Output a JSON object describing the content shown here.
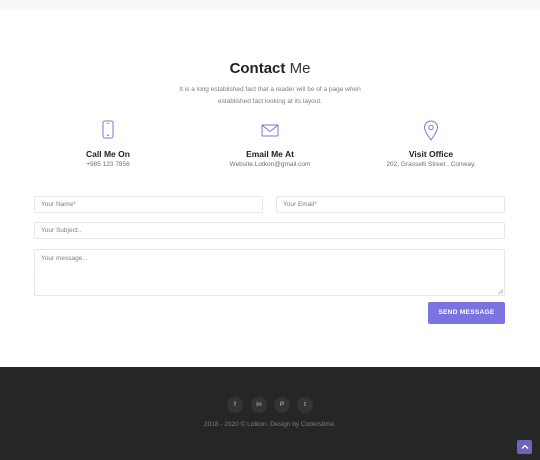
{
  "header": {
    "title_bold": "Contact",
    "title_light": "Me",
    "subtitle": "It is a long established fact that a reader will be of a page when established fact looking at its layout."
  },
  "info": [
    {
      "icon": "phone-icon",
      "label": "Call Me On",
      "value": "+985 123 7856"
    },
    {
      "icon": "mail-icon",
      "label": "Email Me At",
      "value": "Website.Lotkon@gmail.com"
    },
    {
      "icon": "location-pin-icon",
      "label": "Visit Office",
      "value": "202, Grasselli Street , Conway."
    }
  ],
  "form": {
    "name_placeholder": "Your Name*",
    "email_placeholder": "Your Email*",
    "subject_placeholder": "Your Subject..",
    "message_placeholder": "Your message...",
    "send_label": "SEND MESSAGE"
  },
  "footer": {
    "social": [
      {
        "icon": "facebook-icon",
        "glyph": "f"
      },
      {
        "icon": "linkedin-icon",
        "glyph": "in"
      },
      {
        "icon": "pinterest-icon",
        "glyph": "P"
      },
      {
        "icon": "twitter-icon",
        "glyph": "t"
      }
    ],
    "copyright": "2018 - 2020 © Lotkon. Design by Coderstime."
  },
  "colors": {
    "accent": "#7b74e0",
    "footer_bg": "#262626"
  }
}
